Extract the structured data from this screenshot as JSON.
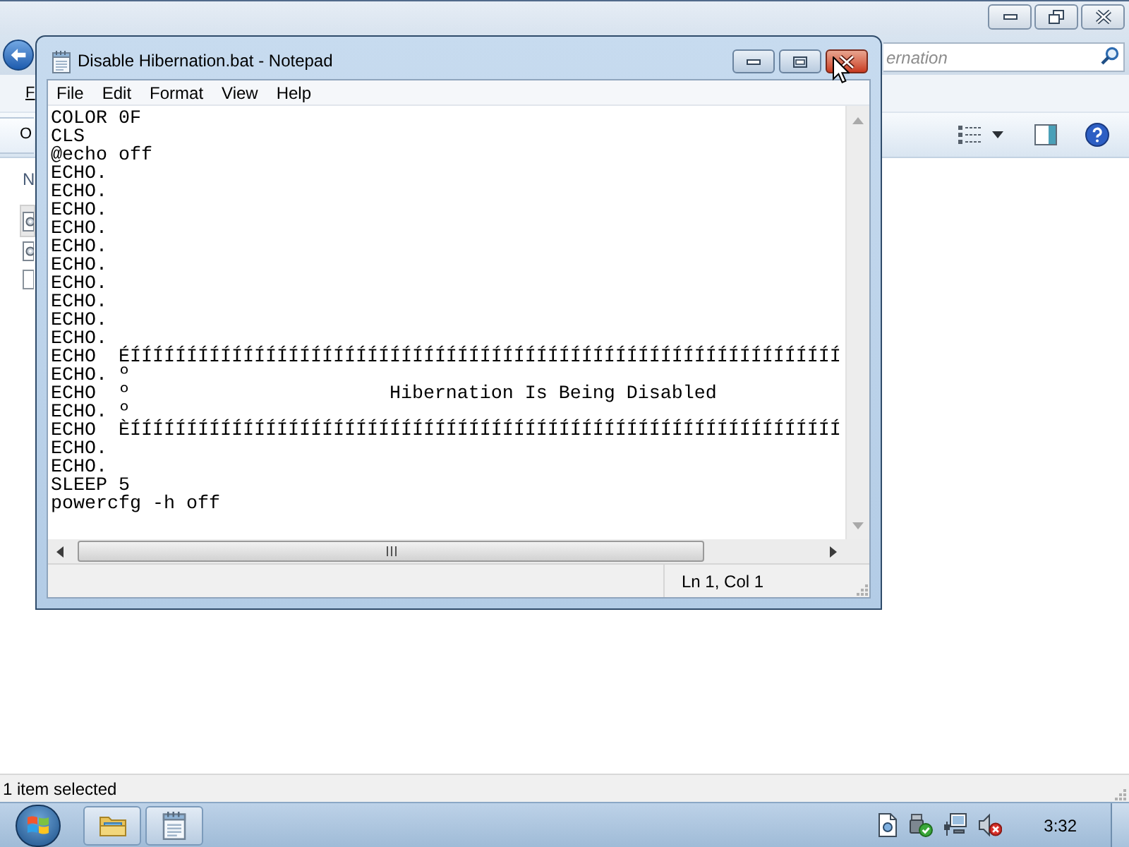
{
  "explorer": {
    "search": {
      "placeholder": "ernation"
    },
    "menu_bar": {
      "label": "F"
    },
    "toolbar": {
      "label": "O"
    },
    "list": {
      "header": "N",
      "items": [
        {
          "kind": "settings-file",
          "selected": true
        },
        {
          "kind": "settings-file",
          "selected": false
        },
        {
          "kind": "blank-file",
          "selected": false
        }
      ]
    },
    "status_bar": "1 item selected"
  },
  "notepad": {
    "title": "Disable Hibernation.bat - Notepad",
    "menu": [
      "File",
      "Edit",
      "Format",
      "View",
      "Help"
    ],
    "lines": [
      "COLOR 0F",
      "CLS",
      "@echo off",
      "ECHO.",
      "ECHO.",
      "ECHO.",
      "ECHO.",
      "ECHO.",
      "ECHO.",
      "ECHO.",
      "ECHO.",
      "ECHO.",
      "ECHO.",
      "ECHO  ÉÍÍÍÍÍÍÍÍÍÍÍÍÍÍÍÍÍÍÍÍÍÍÍÍÍÍÍÍÍÍÍÍÍÍÍÍÍÍÍÍÍÍÍÍÍÍÍÍÍÍÍÍÍÍÍÍÍÍÍÍÍÍÍ",
      "ECHO. º",
      "ECHO  º                       Hibernation Is Being Disabled",
      "ECHO. º",
      "ECHO  ÈÍÍÍÍÍÍÍÍÍÍÍÍÍÍÍÍÍÍÍÍÍÍÍÍÍÍÍÍÍÍÍÍÍÍÍÍÍÍÍÍÍÍÍÍÍÍÍÍÍÍÍÍÍÍÍÍÍÍÍÍÍÍÍ",
      "ECHO.",
      "ECHO.",
      "SLEEP 5",
      "powercfg -h off"
    ],
    "status": "Ln 1, Col 1"
  },
  "taskbar": {
    "apps": [
      {
        "kind": "explorer"
      },
      {
        "kind": "notepad"
      }
    ],
    "tray": [
      {
        "kind": "document"
      },
      {
        "kind": "safe-remove"
      },
      {
        "kind": "network"
      },
      {
        "kind": "muted-speaker"
      }
    ],
    "clock": "3:32"
  }
}
